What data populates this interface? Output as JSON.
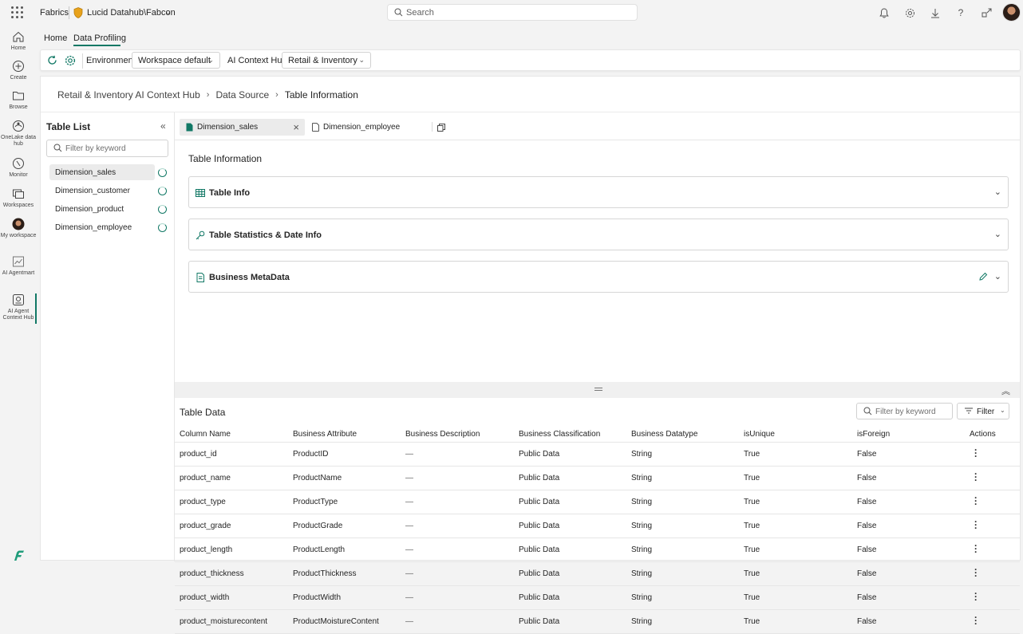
{
  "topbar": {
    "brand": "Fabrics",
    "workspace": "Lucid Datahub\\Fabcon",
    "search_placeholder": "Search",
    "icons": [
      "bell-icon",
      "gear-icon",
      "download-icon",
      "help-icon",
      "share-icon"
    ]
  },
  "leftnav": [
    {
      "label": "Home",
      "icon": "home-icon"
    },
    {
      "label": "Create",
      "icon": "plus-circle-icon"
    },
    {
      "label": "Browse",
      "icon": "folder-icon"
    },
    {
      "label": "OneLake data hub",
      "icon": "onelake-icon"
    },
    {
      "label": "Monitor",
      "icon": "monitor-icon"
    },
    {
      "label": "Workspaces",
      "icon": "workspaces-icon"
    },
    {
      "label": "My workspace",
      "icon": "avatar-icon"
    },
    {
      "label": "AI Agentmart",
      "icon": "chart-icon"
    },
    {
      "label": "AI Agent Context Hub",
      "icon": "hub-icon"
    }
  ],
  "subtabs": {
    "home": "Home",
    "data_profiling": "Data Profiling"
  },
  "toolbar": {
    "environment_label": "Environment",
    "environment_value": "Workspace default",
    "context_label": "AI Context Hub",
    "context_value": "Retail & Inventory"
  },
  "breadcrumb": {
    "items": [
      "Retail & Inventory AI Context Hub",
      "Data Source",
      "Table Information"
    ]
  },
  "table_list": {
    "title": "Table List",
    "filter_placeholder": "Filter by keyword",
    "items": [
      "Dimension_sales",
      "Dimension_customer",
      "Dimension_product",
      "Dimension_employee"
    ],
    "selected": "Dimension_sales"
  },
  "file_tabs": [
    {
      "label": "Dimension_sales",
      "active": true
    },
    {
      "label": "Dimension_employee",
      "active": false
    }
  ],
  "table_information": {
    "title": "Table Information",
    "sections": [
      "Table Info",
      "Table Statistics & Date Info",
      "Business MetaData"
    ]
  },
  "table_data": {
    "title": "Table Data",
    "filter_placeholder": "Filter by keyword",
    "filter_button": "Filter",
    "columns": [
      "Column Name",
      "Business Attribute",
      "Business Description",
      "Business Classification",
      "Business Datatype",
      "isUnique",
      "isForeign",
      "Actions"
    ],
    "rows": [
      [
        "product_id",
        "ProductID",
        "—",
        "Public Data",
        "String",
        "True",
        "False"
      ],
      [
        "product_name",
        "ProductName",
        "—",
        "Public Data",
        "String",
        "True",
        "False"
      ],
      [
        "product_type",
        "ProductType",
        "—",
        "Public Data",
        "String",
        "True",
        "False"
      ],
      [
        "product_grade",
        "ProductGrade",
        "—",
        "Public Data",
        "String",
        "True",
        "False"
      ],
      [
        "product_length",
        "ProductLength",
        "—",
        "Public Data",
        "String",
        "True",
        "False"
      ],
      [
        "product_thickness",
        "ProductThickness",
        "—",
        "Public Data",
        "String",
        "True",
        "False"
      ],
      [
        "product_width",
        "ProductWidth",
        "—",
        "Public Data",
        "String",
        "True",
        "False"
      ],
      [
        "product_moisturecontent",
        "ProductMoistureContent",
        "—",
        "Public Data",
        "String",
        "True",
        "False"
      ]
    ]
  },
  "colors": {
    "accent": "#117865",
    "warning": "#e8a21b"
  }
}
